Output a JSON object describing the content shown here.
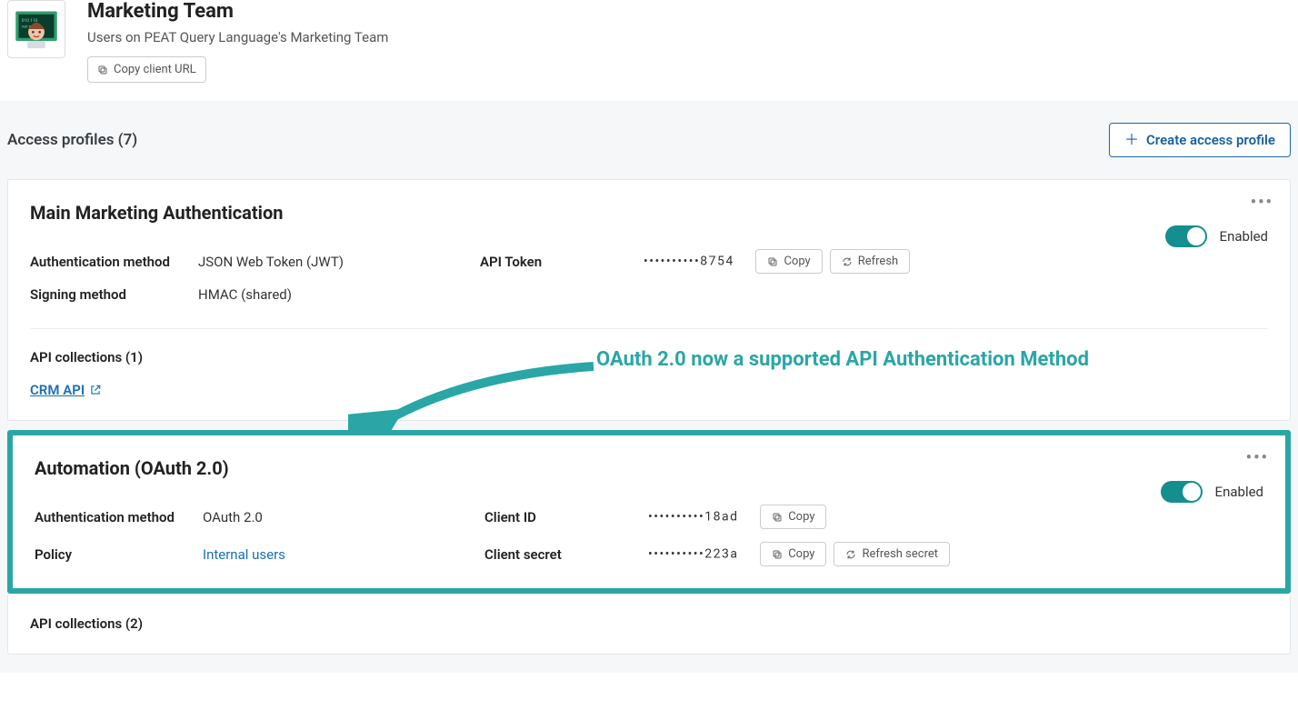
{
  "header": {
    "title": "Marketing Team",
    "subtitle": "Users on PEAT Query Language's Marketing Team",
    "copy_url_label": "Copy client URL"
  },
  "section": {
    "title": "Access profiles (7)",
    "create_label": "Create access profile"
  },
  "card1": {
    "title": "Main Marketing Authentication",
    "enable_label": "Enabled",
    "auth_method_label": "Authentication method",
    "auth_method_value": "JSON Web Token (JWT)",
    "signing_label": "Signing method",
    "signing_value": "HMAC (shared)",
    "token_label": "API Token",
    "token_value": "••••••••••8754",
    "copy_label": "Copy",
    "refresh_label": "Refresh",
    "collections_title": "API collections (1)",
    "collections_link": "CRM API"
  },
  "annotation": "OAuth 2.0 now a supported API Authentication Method",
  "card2": {
    "title": "Automation (OAuth 2.0)",
    "enable_label": "Enabled",
    "auth_method_label": "Authentication method",
    "auth_method_value": "OAuth 2.0",
    "policy_label": "Policy",
    "policy_value": "Internal users",
    "clientid_label": "Client ID",
    "clientid_value": "••••••••••18ad",
    "secret_label": "Client secret",
    "secret_value": "••••••••••223a",
    "copy_label": "Copy",
    "refresh_secret_label": "Refresh secret",
    "collections_title": "API collections (2)"
  }
}
